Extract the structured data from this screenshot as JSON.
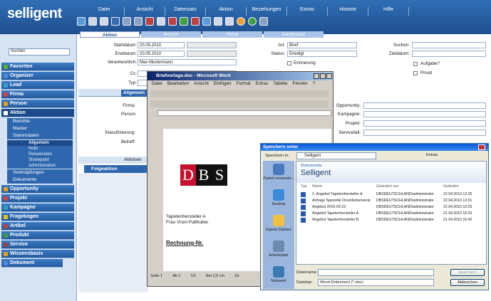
{
  "app": {
    "logo": "selligent"
  },
  "menu": [
    "Datei",
    "Ansicht",
    "Datensatz",
    "Aktion",
    "Beziehungen",
    "Extras",
    "Historie",
    "Hilfe"
  ],
  "sidebar": {
    "search_label": "Suchen",
    "items": [
      {
        "label": "Favoriten",
        "color": "#5ab030"
      },
      {
        "label": "Organizer",
        "color": "#4a8ad8"
      },
      {
        "label": "Lead",
        "color": "#3aa0d0"
      },
      {
        "label": "Firma",
        "color": "#d04040"
      },
      {
        "label": "Person",
        "color": "#e0a020"
      },
      {
        "label": "Aktion",
        "color": "#ffffff"
      }
    ],
    "aktion_sub": [
      "Berichte",
      "Master",
      "Stammdaten"
    ],
    "stammdaten_sub": [
      "Allgemein",
      "Notiz",
      "Reisekosten",
      "Sharepoint",
      "Administration"
    ],
    "aktion_sub2": [
      "Verknüpfungen",
      "Dokumente"
    ],
    "items2": [
      {
        "label": "Opportunity",
        "color": "#e0a020"
      },
      {
        "label": "Projekt",
        "color": "#d04040"
      },
      {
        "label": "Kampagne",
        "color": "#30a0c0"
      },
      {
        "label": "Fragebogen",
        "color": "#e0c020"
      },
      {
        "label": "Artikel",
        "color": "#c04040"
      },
      {
        "label": "Produkt",
        "color": "#40a040"
      },
      {
        "label": "Service",
        "color": "#a04040"
      },
      {
        "label": "Wissensbasis",
        "color": "#e0a020"
      },
      {
        "label": "Dokument",
        "color": "#4a8ad8"
      }
    ]
  },
  "tabs": [
    "Aktion",
    "Person",
    "Firma",
    "Dashboard"
  ],
  "form": {
    "startdatum_label": "Startdatum:",
    "startdatum": "20.05.2010",
    "enddatum_label": "Enddatum:",
    "enddatum": "20.05.2010",
    "verantwortlich_label": "Verantwortlich:",
    "verantwortlich": "Max Mustermann",
    "cc_label": "Cc:",
    "typ_label": "Typ:",
    "art_label": "Art:",
    "art": "Brief",
    "status_label": "Status:",
    "status": "Erledigt",
    "erinnerung_label": "Erinnerung",
    "suchen_label": "Suchen:",
    "zieldatum_label": "Zieldatum:",
    "aufgabe_label": "Aufgabe?",
    "privat_label": "Privat",
    "subtab_allgemein": "Allgemein",
    "firma_label": "Firma:",
    "person_label": "Person",
    "klassifizierung_label": "Klassifizierung:",
    "betreff_label": "Betreff:",
    "opportunity_label": "Opportunity:",
    "kampagne_label": "Kampagne:",
    "projekt_label": "Projekt:",
    "servicefall_label": "Servicefall:",
    "aktionen_label": "Aktionen",
    "folgeaktion_label": "Folgeaktion"
  },
  "word": {
    "title": "Briefvorlage.doc - Microsoft Word",
    "menu": [
      "Datei",
      "Bearbeiten",
      "Ansicht",
      "Einfügen",
      "Format",
      "Extras",
      "Tabelle",
      "Fenster",
      "?"
    ],
    "logo_letters": [
      "D",
      "B",
      "S"
    ],
    "address1": "Tapetenhersteller A",
    "address2": "Frau Vroni Pallhuber",
    "rechnung": "Rechnung-Nr.",
    "status": [
      "Seite 1",
      "Ab 1",
      "1/1",
      "Bei 2,5 cm",
      "Ze"
    ]
  },
  "save_dialog": {
    "title": "Speichern unter",
    "speichern_in_label": "Speichern in:",
    "folder": "Selligent",
    "extras_label": "Extras",
    "places": [
      "Zuletzt verwende...",
      "Desktop",
      "Eigene Dateien",
      "Arbeitsplatz",
      "Netzwerk"
    ],
    "path_label": "Dokumente",
    "path_title": "Selligent",
    "columns": [
      "Typ",
      "Name",
      "Geändert von",
      "Geändert"
    ],
    "files": [
      {
        "name": "2. Angebot Tapetenhersteller A",
        "by": "DBSDEUTSCHLAND\\administrator",
        "date": "22.04.2010 12:25"
      },
      {
        "name": "Anfrage Spezielle Druckfarbenserie",
        "by": "DBSDEUTSCHLAND\\administrator",
        "date": "22.04.2010 12:01"
      },
      {
        "name": "Angebot 2010-03-22",
        "by": "DBSDEUTSCHLAND\\administrator",
        "date": "22.04.2010 10:25"
      },
      {
        "name": "Angebot Tapetenhersteller A",
        "by": "DBSDEUTSCHLAND\\administrator",
        "date": "21.04.2010 16:32"
      },
      {
        "name": "Angebot Tapetenhersteller B",
        "by": "DBSDEUTSCHLAND\\administrator",
        "date": "21.04.2010 16:42"
      }
    ],
    "dateiname_label": "Dateiname:",
    "dateityp_label": "Dateityp:",
    "dateityp": "Word-Dokument (*.doc)",
    "speichern_label": "Speichern",
    "abbrechen_label": "Abbrechen"
  }
}
